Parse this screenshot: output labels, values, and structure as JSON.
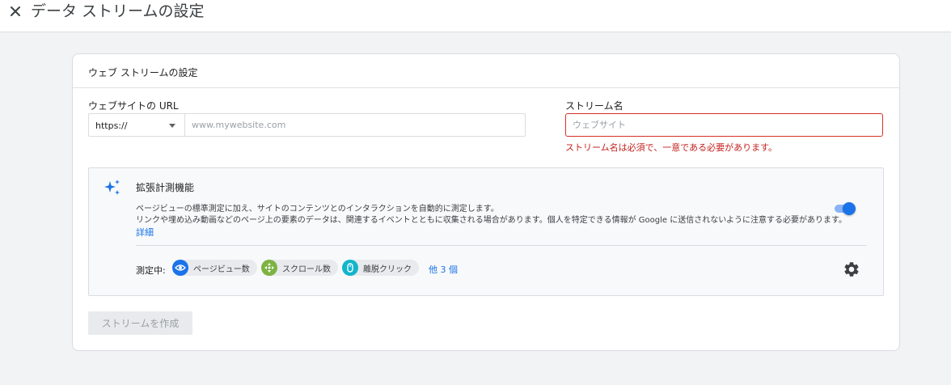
{
  "header": {
    "close_icon": "close-icon",
    "title": "データ ストリームの設定"
  },
  "card": {
    "title": "ウェブ ストリームの設定",
    "url_field": {
      "label": "ウェブサイトの URL",
      "protocol": "https://",
      "placeholder": "www.mywebsite.com",
      "value": ""
    },
    "name_field": {
      "label": "ストリーム名",
      "placeholder": "ウェブサイト",
      "value": "",
      "error": "ストリーム名は必須で、一意である必要があります。"
    },
    "enhanced_measurement": {
      "title": "拡張計測機能",
      "description_line1": "ページビューの標準測定に加え、サイトのコンテンツとのインタラクションを自動的に測定します。",
      "description_line2": "リンクや埋め込み動画などのページ上の要素のデータは、関連するイベントとともに収集される場合があります。個人を特定できる情報が Google に送信されないように注意する必要があります。",
      "learn_more": "詳細",
      "toggle_on": true,
      "measuring_label": "測定中:",
      "chips": [
        {
          "label": "ページビュー数",
          "icon": "eye-icon",
          "color": "#1a73e8"
        },
        {
          "label": "スクロール数",
          "icon": "scroll-crosshair-icon",
          "color": "#7cb342"
        },
        {
          "label": "離脱クリック",
          "icon": "mouse-icon",
          "color": "#12b5cb"
        }
      ],
      "more": "他 3 個",
      "settings_icon": "gear-icon"
    },
    "create_button": "ストリームを作成"
  },
  "colors": {
    "accent": "#1a73e8",
    "error": "#d93025",
    "background": "#f1f3f4"
  }
}
